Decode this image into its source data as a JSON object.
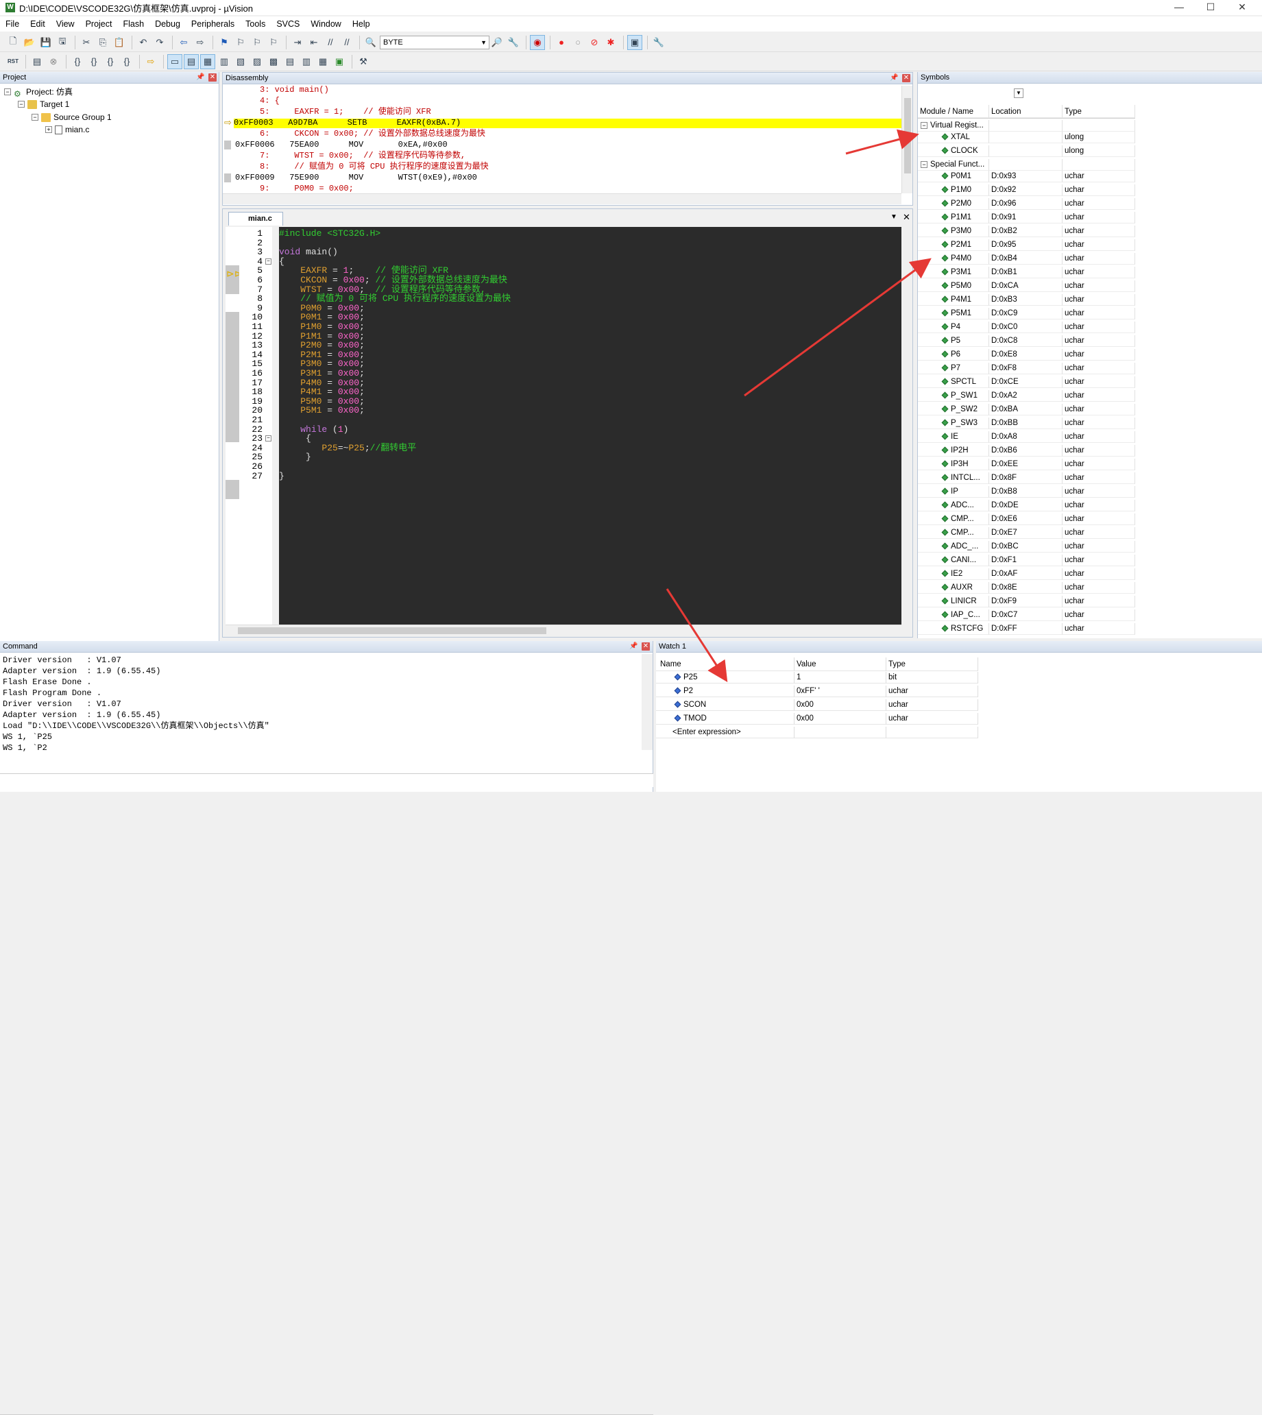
{
  "window": {
    "title": "D:\\IDE\\CODE\\VSCODE32G\\仿真框架\\仿真.uvproj - µVision",
    "app_icon": "W"
  },
  "menu": [
    "File",
    "Edit",
    "View",
    "Project",
    "Flash",
    "Debug",
    "Peripherals",
    "Tools",
    "SVCS",
    "Window",
    "Help"
  ],
  "toolbar": {
    "byte_combo": "BYTE"
  },
  "project": {
    "header": "Project",
    "root": "Project: 仿真",
    "target": "Target 1",
    "group": "Source Group 1",
    "file": "mian.c"
  },
  "disassembly": {
    "header": "Disassembly",
    "lines": [
      {
        "text": "     3: void main()",
        "kind": "src"
      },
      {
        "text": "     4: {",
        "kind": "src"
      },
      {
        "text": "     5:     EAXFR = 1;    // 使能访问 XFR",
        "kind": "src"
      },
      {
        "text": "0xFF0003   A9D7BA      SETB      EAXFR(0xBA.7)",
        "kind": "cur"
      },
      {
        "text": "     6:     CKCON = 0x00; // 设置外部数据总线速度为最快",
        "kind": "src"
      },
      {
        "text": "0xFF0006   75EA00      MOV       0xEA,#0x00",
        "kind": "asm"
      },
      {
        "text": "     7:     WTST = 0x00;  // 设置程序代码等待参数,",
        "kind": "src"
      },
      {
        "text": "     8:     // 赋值为 0 可将 CPU 执行程序的速度设置为最快",
        "kind": "src"
      },
      {
        "text": "0xFF0009   75E900      MOV       WTST(0xE9),#0x00",
        "kind": "asm"
      },
      {
        "text": "     9:     P0M0 = 0x00;",
        "kind": "src"
      }
    ]
  },
  "editor": {
    "tab": "mian.c",
    "lines": [
      "#include <STC32G.H>",
      "",
      "void main()",
      "{",
      "    EAXFR = 1;    // 使能访问 XFR",
      "    CKCON = 0x00; // 设置外部数据总线速度为最快",
      "    WTST = 0x00;  // 设置程序代码等待参数,",
      "    // 赋值为 0 可将 CPU 执行程序的速度设置为最快",
      "    P0M0 = 0x00;",
      "    P0M1 = 0x00;",
      "    P1M0 = 0x00;",
      "    P1M1 = 0x00;",
      "    P2M0 = 0x00;",
      "    P2M1 = 0x00;",
      "    P3M0 = 0x00;",
      "    P3M1 = 0x00;",
      "    P4M0 = 0x00;",
      "    P4M1 = 0x00;",
      "    P5M0 = 0x00;",
      "    P5M1 = 0x00;",
      "",
      "    while (1)",
      "     {",
      "        P25=~P25;//翻转电平",
      "     }",
      "",
      "}"
    ],
    "current_line": 5
  },
  "symbols": {
    "header": "Symbols",
    "columns": [
      "Module / Name",
      "Location",
      "Type"
    ],
    "group1": "Virtual Regist...",
    "group1_items": [
      {
        "name": "XTAL",
        "loc": "",
        "type": "ulong"
      },
      {
        "name": "CLOCK",
        "loc": "",
        "type": "ulong"
      }
    ],
    "group2": "Special Funct...",
    "group2_items": [
      {
        "name": "P0M1",
        "loc": "D:0x93",
        "type": "uchar"
      },
      {
        "name": "P1M0",
        "loc": "D:0x92",
        "type": "uchar"
      },
      {
        "name": "P2M0",
        "loc": "D:0x96",
        "type": "uchar"
      },
      {
        "name": "P1M1",
        "loc": "D:0x91",
        "type": "uchar"
      },
      {
        "name": "P3M0",
        "loc": "D:0xB2",
        "type": "uchar"
      },
      {
        "name": "P2M1",
        "loc": "D:0x95",
        "type": "uchar"
      },
      {
        "name": "P4M0",
        "loc": "D:0xB4",
        "type": "uchar"
      },
      {
        "name": "P3M1",
        "loc": "D:0xB1",
        "type": "uchar"
      },
      {
        "name": "P5M0",
        "loc": "D:0xCA",
        "type": "uchar"
      },
      {
        "name": "P4M1",
        "loc": "D:0xB3",
        "type": "uchar"
      },
      {
        "name": "P5M1",
        "loc": "D:0xC9",
        "type": "uchar"
      },
      {
        "name": "P4",
        "loc": "D:0xC0",
        "type": "uchar"
      },
      {
        "name": "P5",
        "loc": "D:0xC8",
        "type": "uchar"
      },
      {
        "name": "P6",
        "loc": "D:0xE8",
        "type": "uchar"
      },
      {
        "name": "P7",
        "loc": "D:0xF8",
        "type": "uchar"
      },
      {
        "name": "SPCTL",
        "loc": "D:0xCE",
        "type": "uchar"
      },
      {
        "name": "P_SW1",
        "loc": "D:0xA2",
        "type": "uchar"
      },
      {
        "name": "P_SW2",
        "loc": "D:0xBA",
        "type": "uchar"
      },
      {
        "name": "P_SW3",
        "loc": "D:0xBB",
        "type": "uchar"
      },
      {
        "name": "IE",
        "loc": "D:0xA8",
        "type": "uchar"
      },
      {
        "name": "IP2H",
        "loc": "D:0xB6",
        "type": "uchar"
      },
      {
        "name": "IP3H",
        "loc": "D:0xEE",
        "type": "uchar"
      },
      {
        "name": "INTCL...",
        "loc": "D:0x8F",
        "type": "uchar"
      },
      {
        "name": "IP",
        "loc": "D:0xB8",
        "type": "uchar"
      },
      {
        "name": "ADC...",
        "loc": "D:0xDE",
        "type": "uchar"
      },
      {
        "name": "CMP...",
        "loc": "D:0xE6",
        "type": "uchar"
      },
      {
        "name": "CMP...",
        "loc": "D:0xE7",
        "type": "uchar"
      },
      {
        "name": "ADC_...",
        "loc": "D:0xBC",
        "type": "uchar"
      },
      {
        "name": "CANI...",
        "loc": "D:0xF1",
        "type": "uchar"
      },
      {
        "name": "IE2",
        "loc": "D:0xAF",
        "type": "uchar"
      },
      {
        "name": "AUXR",
        "loc": "D:0x8E",
        "type": "uchar"
      },
      {
        "name": "LINICR",
        "loc": "D:0xF9",
        "type": "uchar"
      },
      {
        "name": "IAP_C...",
        "loc": "D:0xC7",
        "type": "uchar"
      },
      {
        "name": "RSTCFG",
        "loc": "D:0xFF",
        "type": "uchar"
      }
    ]
  },
  "command": {
    "header": "Command",
    "lines": [
      "Driver version   : V1.07",
      "Adapter version  : 1.9 (6.55.45)",
      "Flash Erase Done .",
      "Flash Program Done .",
      "Driver version   : V1.07",
      "Adapter version  : 1.9 (6.55.45)",
      "Load \"D:\\\\IDE\\\\CODE\\\\VSCODE32G\\\\仿真框架\\\\Objects\\\\仿真\"",
      "WS 1, `P25",
      "WS 1, `P2"
    ]
  },
  "watch": {
    "header": "Watch 1",
    "columns": [
      "Name",
      "Value",
      "Type"
    ],
    "rows": [
      {
        "name": "P25",
        "value": "1",
        "type": "bit"
      },
      {
        "name": "P2",
        "value": "0xFF'  '",
        "type": "uchar"
      },
      {
        "name": "SCON",
        "value": "0x00",
        "type": "uchar"
      },
      {
        "name": "TMOD",
        "value": "0x00",
        "type": "uchar"
      }
    ],
    "enter": "<Enter expression>"
  },
  "colors": {
    "highlight": "#ffff00",
    "editor_bg": "#2b2b2b",
    "keyword": "#c678dd",
    "comment": "#32cd32",
    "number": "#ff66cc",
    "ident": "#e0a030",
    "arrow": "#e53935"
  }
}
